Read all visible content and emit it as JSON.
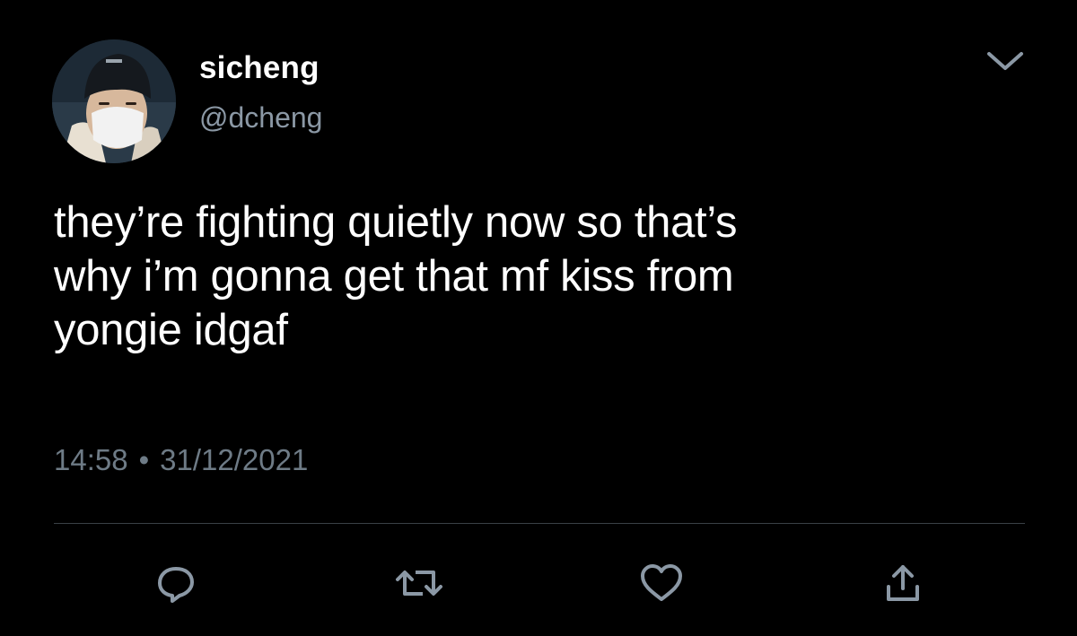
{
  "user": {
    "display_name": "sicheng",
    "handle": "@dcheng"
  },
  "tweet": {
    "text": "they’re fighting quietly now so that’s\nwhy i’m gonna get that mf kiss from\nyongie idgaf",
    "time": "14:58",
    "separator": "•",
    "date": "31/12/2021"
  },
  "icons": {
    "menu": "chevron-down-icon",
    "actions": [
      "reply-icon",
      "retweet-icon",
      "like-icon",
      "share-icon"
    ]
  },
  "colors": {
    "background": "#000000",
    "text": "#ffffff",
    "secondary_text": "#8b98a5",
    "icon": "#8b98a5",
    "divider": "#3a4046"
  }
}
